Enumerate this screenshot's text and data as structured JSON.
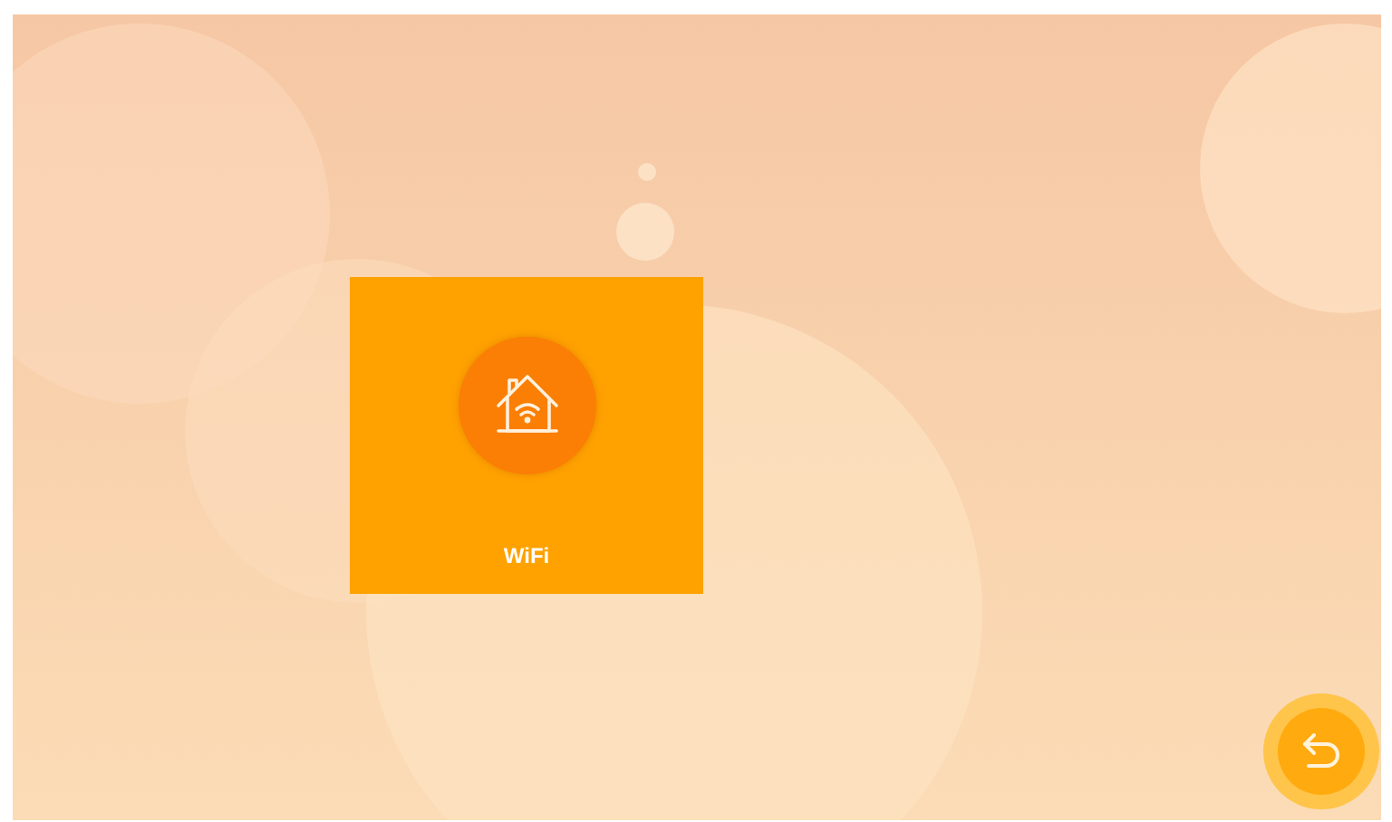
{
  "tiles": [
    {
      "label": "WiFi"
    }
  ]
}
